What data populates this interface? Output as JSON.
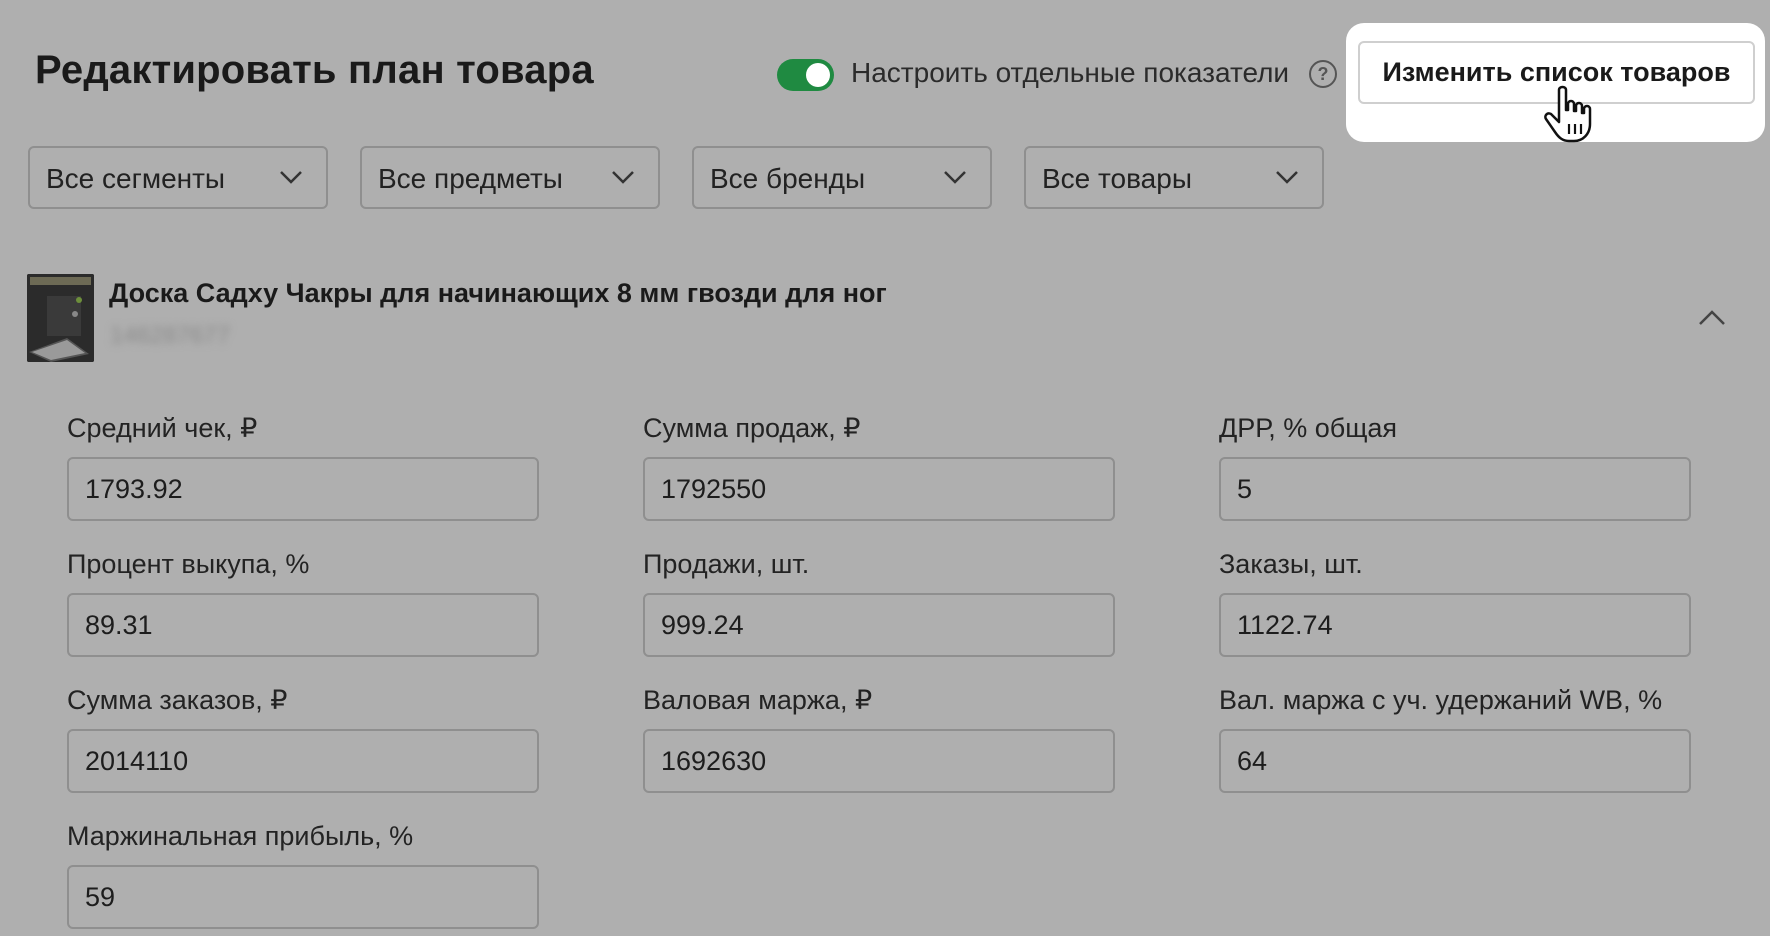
{
  "header": {
    "title": "Редактировать план товара",
    "toggle_label": "Настроить отдельные показатели",
    "toggle_on": true,
    "help_icon": "?",
    "change_list_button": "Изменить список товаров"
  },
  "filters": [
    {
      "label": "Все сегменты"
    },
    {
      "label": "Все предметы"
    },
    {
      "label": "Все бренды"
    },
    {
      "label": "Все товары"
    }
  ],
  "product": {
    "name": "Доска Садху Чакры для начинающих 8 мм гвозди для ног",
    "sku": "146287677"
  },
  "fields": [
    {
      "label": "Средний чек, ₽",
      "value": "1793.92"
    },
    {
      "label": "Сумма продаж, ₽",
      "value": "1792550"
    },
    {
      "label": "ДРР, % общая",
      "value": "5"
    },
    {
      "label": "Процент выкупа, %",
      "value": "89.31"
    },
    {
      "label": "Продажи, шт.",
      "value": "999.24"
    },
    {
      "label": "Заказы, шт.",
      "value": "1122.74"
    },
    {
      "label": "Сумма заказов, ₽",
      "value": "2014110"
    },
    {
      "label": "Валовая маржа, ₽",
      "value": "1692630"
    },
    {
      "label": "Вал. маржа с уч. удержаний WB, %",
      "value": "64"
    },
    {
      "label": "Маржинальная прибыль, %",
      "value": "59"
    }
  ],
  "colors": {
    "background": "#afafaf",
    "toggle_on": "#1f8a41",
    "input_border": "#8f8f8f"
  }
}
